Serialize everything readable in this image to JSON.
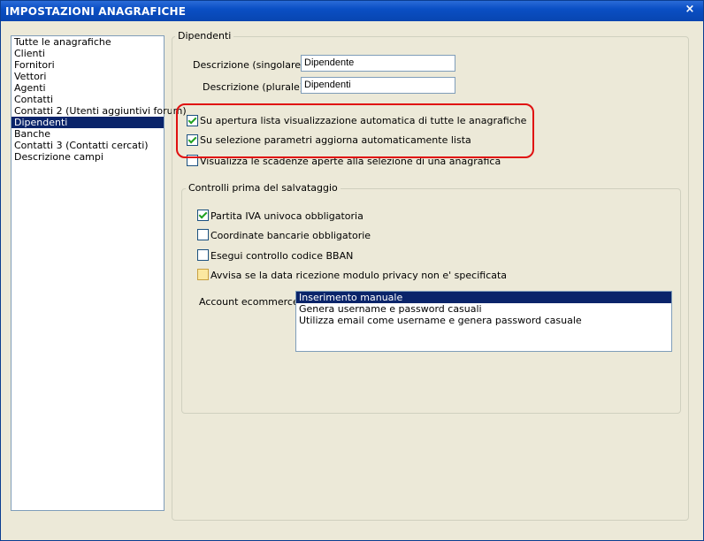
{
  "window": {
    "title": "IMPOSTAZIONI ANAGRAFICHE",
    "close_glyph": "×"
  },
  "sidebar": {
    "items": [
      {
        "label": "Tutte le anagrafiche",
        "selected": false
      },
      {
        "label": "Clienti",
        "selected": false
      },
      {
        "label": "Fornitori",
        "selected": false
      },
      {
        "label": "Vettori",
        "selected": false
      },
      {
        "label": "Agenti",
        "selected": false
      },
      {
        "label": "Contatti",
        "selected": false
      },
      {
        "label": "Contatti 2 (Utenti aggiuntivi forum)",
        "selected": false
      },
      {
        "label": "Dipendenti",
        "selected": true
      },
      {
        "label": "Banche",
        "selected": false
      },
      {
        "label": "Contatti 3 (Contatti cercati)",
        "selected": false
      },
      {
        "label": "Descrizione campi",
        "selected": false
      }
    ]
  },
  "main": {
    "group_title": "Dipendenti",
    "desc_singolare_label": "Descrizione (singolare) :",
    "desc_singolare_value": "Dipendente",
    "desc_plurale_label": "Descrizione (plurale) :",
    "desc_plurale_value": "Dipendenti",
    "options": [
      {
        "label": "Su apertura lista visualizzazione automatica di tutte le anagrafiche",
        "checked": true
      },
      {
        "label": "Su selezione parametri aggiorna automaticamente lista",
        "checked": true
      },
      {
        "label": "Visualizza le scadenze aperte alla selezione di una anagrafica",
        "checked": false
      }
    ],
    "controls": {
      "title": "Controlli prima del salvataggio",
      "items": [
        {
          "label": "Partita IVA univoca obbligatoria",
          "checked": true
        },
        {
          "label": "Coordinate bancarie obbligatorie",
          "checked": false
        },
        {
          "label": "Esegui controllo codice BBAN",
          "checked": false
        },
        {
          "label": "Avvisa se la data ricezione modulo privacy non e' specificata",
          "checked": false
        }
      ],
      "account_label": "Account ecommerce :",
      "account_options": [
        {
          "label": "Inserimento manuale",
          "selected": true
        },
        {
          "label": "Genera username e password casuali",
          "selected": false
        },
        {
          "label": "Utilizza email come username e genera password casuale",
          "selected": false
        }
      ]
    }
  },
  "colors": {
    "title_bar": "#0a4fc4",
    "selection": "#0a246a",
    "highlight": "#e01010",
    "check": "#21a121"
  }
}
